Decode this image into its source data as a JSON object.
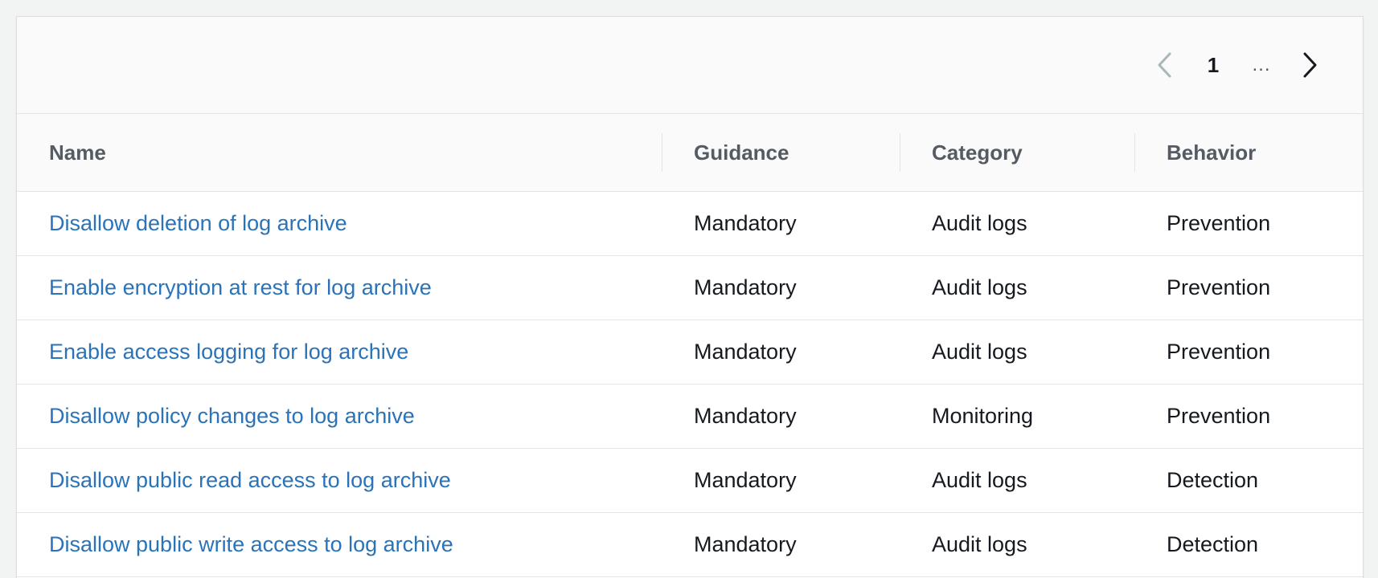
{
  "pagination": {
    "current_page": "1",
    "ellipsis": "...",
    "prev_icon": "chevron-left-icon",
    "next_icon": "chevron-right-icon"
  },
  "table": {
    "columns": [
      "Name",
      "Guidance",
      "Category",
      "Behavior"
    ],
    "rows": [
      {
        "name": "Disallow deletion of log archive",
        "guidance": "Mandatory",
        "category": "Audit logs",
        "behavior": "Prevention"
      },
      {
        "name": "Enable encryption at rest for log archive",
        "guidance": "Mandatory",
        "category": "Audit logs",
        "behavior": "Prevention"
      },
      {
        "name": "Enable access logging for log archive",
        "guidance": "Mandatory",
        "category": "Audit logs",
        "behavior": "Prevention"
      },
      {
        "name": "Disallow policy changes to log archive",
        "guidance": "Mandatory",
        "category": "Monitoring",
        "behavior": "Prevention"
      },
      {
        "name": "Disallow public read access to log archive",
        "guidance": "Mandatory",
        "category": "Audit logs",
        "behavior": "Detection"
      },
      {
        "name": "Disallow public write access to log archive",
        "guidance": "Mandatory",
        "category": "Audit logs",
        "behavior": "Detection"
      }
    ]
  },
  "colors": {
    "link": "#2a73b8",
    "header_text": "#545b64",
    "body_text": "#16191f",
    "border": "#e3e5e5",
    "background": "#f2f3f3"
  }
}
